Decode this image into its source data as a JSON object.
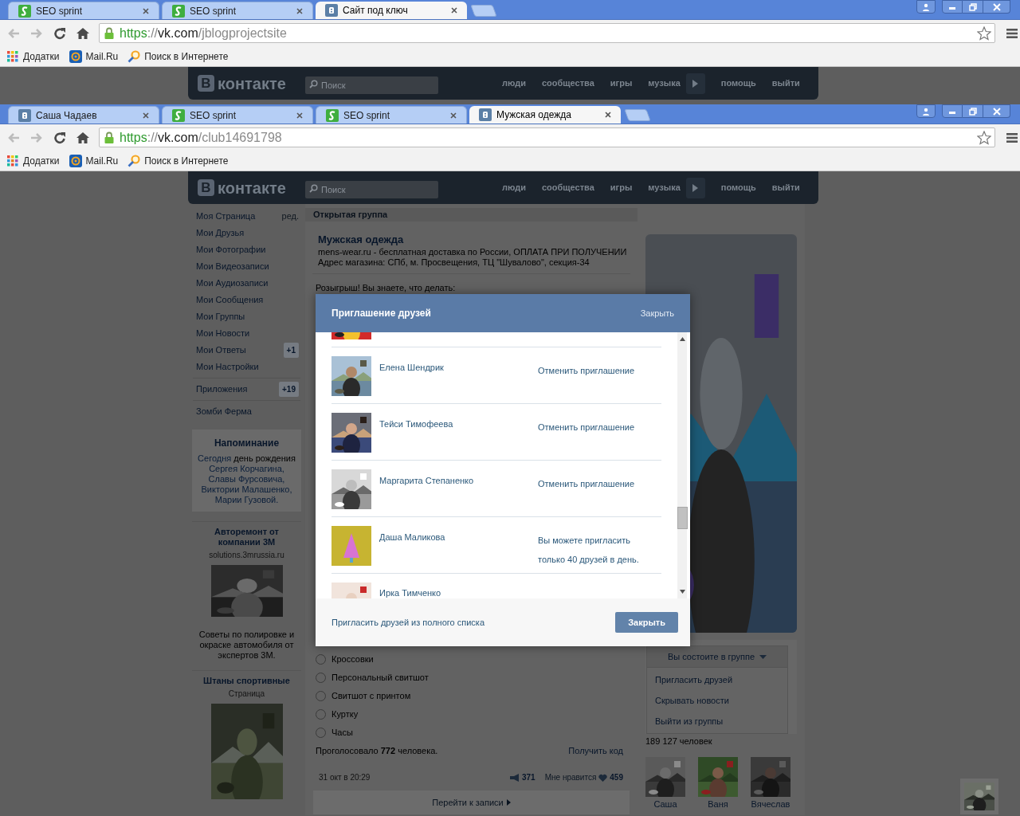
{
  "windows": [
    {
      "tabs": [
        {
          "title": "SEO sprint",
          "kind": "seo",
          "selected": false
        },
        {
          "title": "SEO sprint",
          "kind": "seo",
          "selected": false
        },
        {
          "title": "Сайт под ключ",
          "kind": "vk",
          "selected": true
        }
      ],
      "address": {
        "scheme": "https",
        "separator": "://",
        "host": "vk.com",
        "path": "/jblogprojectsite"
      },
      "bookmarks": [
        {
          "label": "Додатки",
          "kind": "apps"
        },
        {
          "label": "Mail.Ru",
          "kind": "mail"
        },
        {
          "label": "Поиск в Интернете",
          "kind": "search"
        }
      ],
      "site_header": {
        "logo_mark": "В",
        "logo_text": "контакте",
        "search_placeholder": "Поиск",
        "nav": [
          "люди",
          "сообщества",
          "игры",
          "музыка",
          "помощь",
          "выйти"
        ]
      }
    },
    {
      "tabs": [
        {
          "title": "Саша Чадаев",
          "kind": "vk",
          "selected": false
        },
        {
          "title": "SEO sprint",
          "kind": "seo",
          "selected": false
        },
        {
          "title": "SEO sprint",
          "kind": "seo",
          "selected": false
        },
        {
          "title": "Мужская одежда",
          "kind": "vk",
          "selected": true
        }
      ],
      "address": {
        "scheme": "https",
        "separator": "://",
        "host": "vk.com",
        "path": "/club14691798"
      },
      "bookmarks": [
        {
          "label": "Додатки",
          "kind": "apps"
        },
        {
          "label": "Mail.Ru",
          "kind": "mail"
        },
        {
          "label": "Поиск в Интернете",
          "kind": "search"
        }
      ],
      "site_header": {
        "logo_mark": "В",
        "logo_text": "контакте",
        "search_placeholder": "Поиск",
        "nav": [
          "люди",
          "сообщества",
          "игры",
          "музыка",
          "помощь",
          "выйти"
        ]
      }
    }
  ],
  "sidebar": {
    "sections": [
      [
        {
          "label": "Моя Страница",
          "aside": "ред."
        },
        {
          "label": "Мои Друзья"
        },
        {
          "label": "Мои Фотографии"
        },
        {
          "label": "Мои Видеозаписи"
        },
        {
          "label": "Мои Аудиозаписи"
        },
        {
          "label": "Мои Сообщения"
        },
        {
          "label": "Мои Группы"
        },
        {
          "label": "Мои Новости"
        },
        {
          "label": "Мои Ответы",
          "badge": "+1"
        },
        {
          "label": "Мои Настройки"
        }
      ],
      [
        {
          "label": "Приложения",
          "badge": "+19"
        }
      ],
      [
        {
          "label": "Зомби Ферма"
        }
      ]
    ],
    "reminder": {
      "title": "Напоминание",
      "segments": [
        {
          "text": "Сегодня",
          "link": true
        },
        {
          "text": "день рождения",
          "link": false
        },
        {
          "text": "Сергея Корчагина,",
          "link": true
        },
        {
          "text": "Славы Фурсовича,",
          "link": true
        },
        {
          "text": "Виктории Малашенко,",
          "link": true
        },
        {
          "text": "Марии Гузовой.",
          "link": true
        }
      ]
    },
    "ads": [
      {
        "title": "Авторемонт от компании 3М",
        "subtitle": "solutions.3mrussia.ru",
        "text": "Советы по полировке и окраске автомобиля от экспертов 3М."
      },
      {
        "title": "Штаны спортивные",
        "subtitle": "Страница"
      }
    ]
  },
  "group": {
    "type_label": "Открытая группа",
    "name": "Мужская одежда",
    "description": [
      "mens-wear.ru - бесплатная доставка по России, ОПЛАТА ПРИ ПОЛУЧЕНИИ",
      "Адрес магазина: СПб, м. Просвещения, ТЦ \"Шувалово\", секция-34"
    ],
    "post": {
      "text": "Розыгрыш! Вы знаете, что делать:",
      "poll_options": [
        {
          "label": "Кроссовки",
          "selected": false
        },
        {
          "label": "Персональный свитшот",
          "selected": false
        },
        {
          "label": "Свитшот с принтом",
          "selected": false
        },
        {
          "label": "Куртку",
          "selected": false
        },
        {
          "label": "Часы",
          "selected": false
        }
      ],
      "poll_total": "Проголосовало **772** человека.",
      "get_code": "Получить код",
      "date": "31 окт в 20:29",
      "reposts": "371",
      "likes_label": "Мне нравится",
      "likes": "459",
      "open_post": "Перейти к записи"
    }
  },
  "group_side": {
    "membership": "Вы состоите в группе",
    "menu": [
      "Пригласить друзей",
      "Скрывать новости",
      "Выйти из группы"
    ],
    "members_count": "189 127 человек",
    "members": [
      {
        "name": "Саша"
      },
      {
        "name": "Ваня"
      },
      {
        "name": "Вячеслав"
      }
    ]
  },
  "invite_dialog": {
    "title": "Приглашение друзей",
    "header_close": "Закрыть",
    "friends": [
      {
        "kind": "partial"
      },
      {
        "kind": "invited",
        "name": "Елена Шендрик",
        "action": "Отменить приглашение"
      },
      {
        "kind": "invited",
        "name": "Тейси Тимофеева",
        "action": "Отменить приглашение"
      },
      {
        "kind": "invited",
        "name": "Маргарита Степаненко",
        "action": "Отменить приглашение"
      },
      {
        "kind": "limit",
        "name": "Даша Маликова",
        "note": "Вы можете пригласить только 40 друзей в день."
      },
      {
        "kind": "cut",
        "name": "Ирка Тимченко"
      }
    ],
    "full_list_link": "Пригласить друзей из полного списка",
    "close_button": "Закрыть"
  }
}
